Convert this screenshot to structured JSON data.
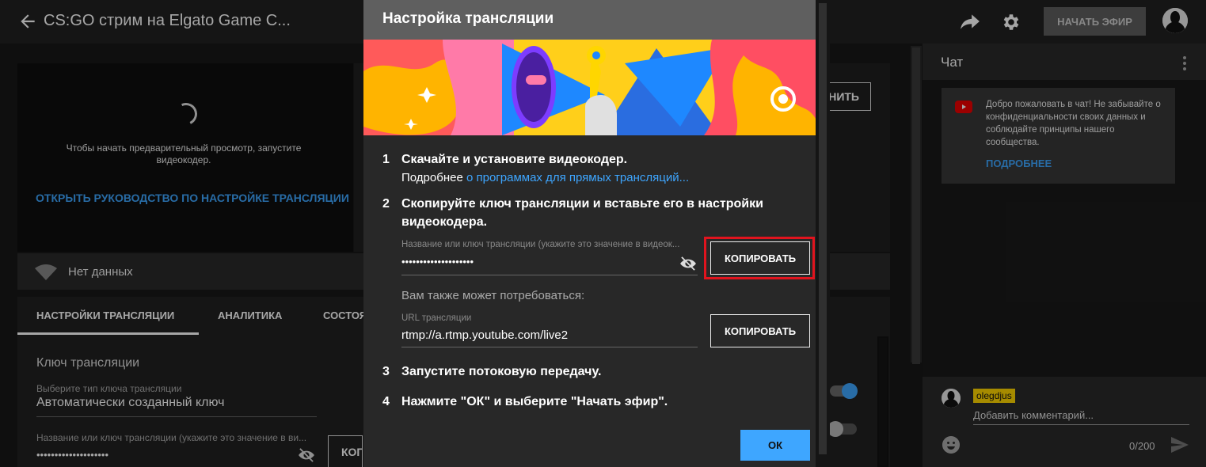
{
  "topbar": {
    "title": "CS:GO стрим на Elgato Game C...",
    "go_live_label": "НАЧАТЬ ЭФИР"
  },
  "preview": {
    "message": "Чтобы начать предварительный просмотр, запустите видеокодер.",
    "guide_link": "ОТКРЫТЬ РУКОВОДСТВО ПО НАСТРОЙКЕ ТРАНСЛЯЦИИ",
    "save_label": "НИТЬ"
  },
  "health": {
    "status": "Нет данных"
  },
  "tabs": [
    {
      "label": "НАСТРОЙКИ ТРАНСЛЯЦИИ"
    },
    {
      "label": "АНАЛИТИКА"
    },
    {
      "label": "СОСТОЯ"
    }
  ],
  "settings": {
    "heading": "Ключ трансляции",
    "key_type_label": "Выберите тип ключа трансляции",
    "key_type_value": "Автоматически созданный ключ",
    "key_name_label": "Название или ключ трансляции (укажите это значение в ви...",
    "key_name_value": "••••••••••••••••••••",
    "copy_label": "КОПИ"
  },
  "dialog": {
    "title": "Настройка трансляции",
    "steps": [
      {
        "num": "1",
        "text": "Скачайте и установите видеокодер."
      },
      {
        "num": "2",
        "text": "Скопируйте ключ трансляции и вставьте его в настройки видеокодера."
      },
      {
        "num": "3",
        "text": "Запустите потоковую передачу."
      },
      {
        "num": "4",
        "text": "Нажмите \"ОК\" и выберите \"Начать эфир\"."
      }
    ],
    "step1_more_prefix": "Подробнее",
    "step1_more_link": "о программах для прямых трансляций...",
    "key_label": "Название или ключ трансляции (укажите это значение в видеок...",
    "key_value": "••••••••••••••••••••",
    "copy_label": "КОПИРОВАТЬ",
    "also_needed": "Вам также может потребоваться:",
    "url_label": "URL трансляции",
    "url_value": "rtmp://a.rtmp.youtube.com/live2",
    "copy_url_label": "КОПИРОВАТЬ",
    "ok_label": "ОК"
  },
  "chat": {
    "title": "Чат",
    "welcome_text": "Добро пожаловать в чат! Не забывайте о конфиденциальности своих данных и соблюдайте принципы нашего сообщества.",
    "learn_more": "ПОДРОБНЕЕ",
    "username": "olegdjus",
    "comment_placeholder": "Добавить комментарий...",
    "counter": "0/200"
  },
  "colors": {
    "accent": "#3ea6ff",
    "highlight": "#e0141e",
    "username_bg": "#ffd600"
  }
}
